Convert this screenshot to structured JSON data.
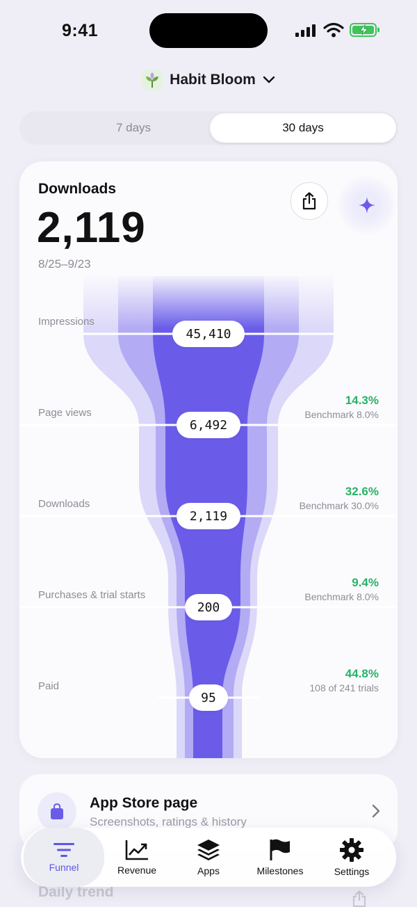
{
  "status_bar": {
    "time": "9:41"
  },
  "app_switcher": {
    "name": "Habit Bloom",
    "icon": "plant-icon"
  },
  "range": {
    "options": [
      "7 days",
      "30 days"
    ],
    "selected": "30 days"
  },
  "summary": {
    "title": "Downloads",
    "value": "2,119",
    "date_range": "8/25–9/23"
  },
  "funnel": {
    "stages": [
      {
        "label": "Impressions",
        "value": "45,410"
      },
      {
        "label": "Page views",
        "value": "6,492",
        "rate": "14.3%",
        "benchmark": "Benchmark 8.0%"
      },
      {
        "label": "Downloads",
        "value": "2,119",
        "rate": "32.6%",
        "benchmark": "Benchmark 30.0%"
      },
      {
        "label": "Purchases & trial starts",
        "value": "200",
        "rate": "9.4%",
        "benchmark": "Benchmark 8.0%"
      },
      {
        "label": "Paid",
        "value": "95",
        "rate": "44.8%",
        "benchmark": "108 of 241 trials"
      }
    ],
    "colors": {
      "core": "#6a5ce9",
      "mid": "#b3abf4",
      "outer": "#dcd8f9",
      "positive": "#27b366"
    }
  },
  "store_page": {
    "title": "App Store page",
    "subtitle": "Screenshots, ratings & history"
  },
  "daily_trend": {
    "title": "Daily trend"
  },
  "tabs": [
    {
      "label": "Funnel",
      "icon": "funnel-icon",
      "active": true
    },
    {
      "label": "Revenue",
      "icon": "chart-icon"
    },
    {
      "label": "Apps",
      "icon": "layers-icon"
    },
    {
      "label": "Milestones",
      "icon": "flag-icon"
    },
    {
      "label": "Settings",
      "icon": "gear-icon"
    }
  ]
}
